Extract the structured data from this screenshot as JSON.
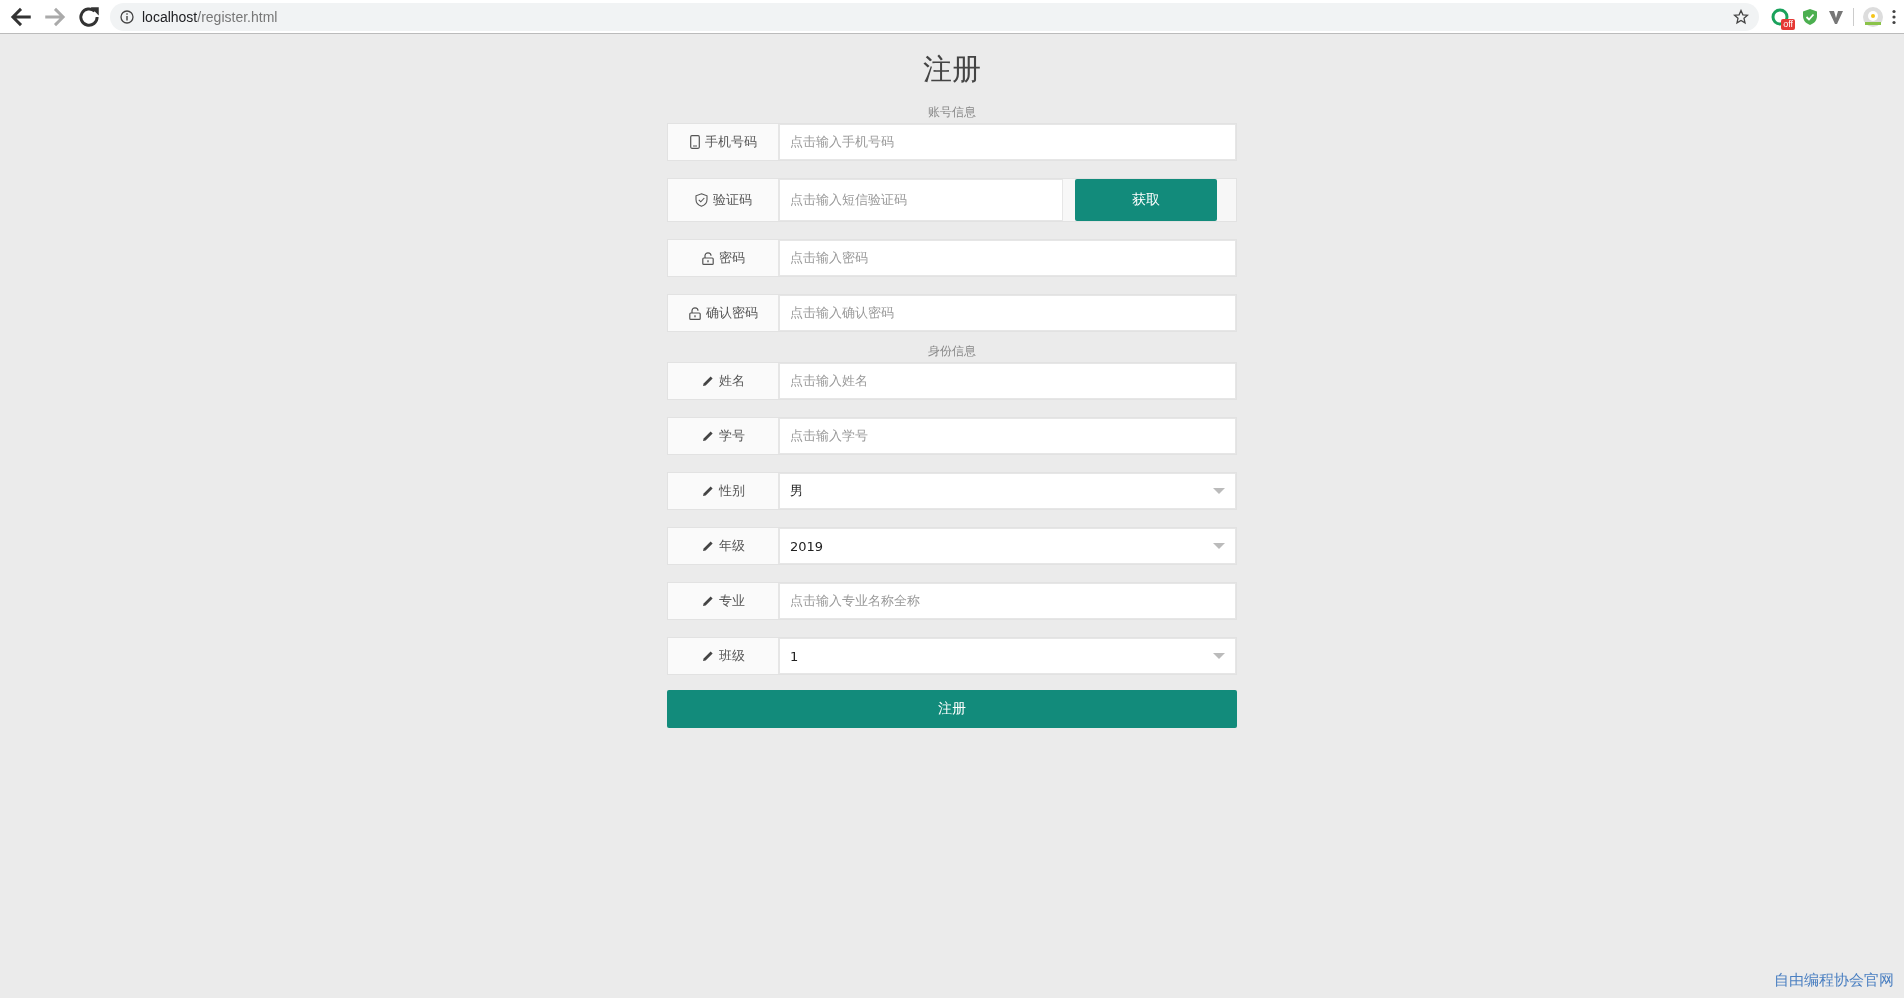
{
  "browser": {
    "url_host": "localhost",
    "url_path": "/register.html",
    "forward_disabled": true,
    "extension_badge": "off"
  },
  "title": "注册",
  "sections": [
    {
      "heading": "账号信息",
      "fields": [
        {
          "kind": "text",
          "label": "手机号码",
          "placeholder": "点击输入手机号码"
        },
        {
          "kind": "code",
          "label": "验证码",
          "placeholder": "点击输入短信验证码",
          "button": "获取"
        },
        {
          "kind": "text",
          "label": "密码",
          "placeholder": "点击输入密码"
        },
        {
          "kind": "text",
          "label": "确认密码",
          "placeholder": "点击输入确认密码"
        }
      ]
    },
    {
      "heading": "身份信息",
      "fields": [
        {
          "kind": "text",
          "label": "姓名",
          "placeholder": "点击输入姓名"
        },
        {
          "kind": "text",
          "label": "学号",
          "placeholder": "点击输入学号"
        },
        {
          "kind": "select",
          "label": "性别",
          "value": "男"
        },
        {
          "kind": "select",
          "label": "年级",
          "value": "2019"
        },
        {
          "kind": "text",
          "label": "专业",
          "placeholder": "点击输入专业名称全称"
        },
        {
          "kind": "select",
          "label": "班级",
          "value": "1"
        }
      ]
    }
  ],
  "submit": "注册",
  "footer_link": "自由编程协会官网"
}
